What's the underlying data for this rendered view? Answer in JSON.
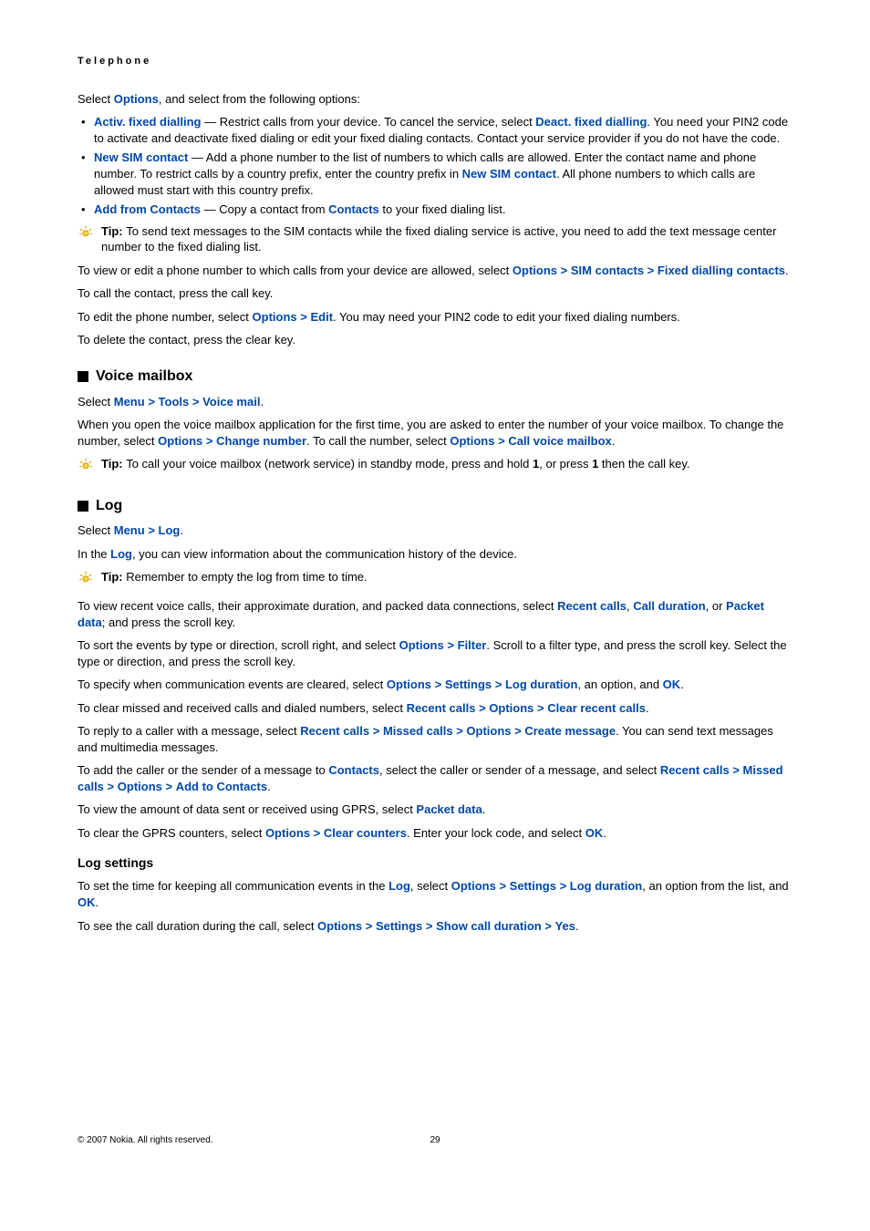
{
  "header": "Telephone",
  "p1": {
    "a": "Select ",
    "b": "Options",
    "c": ", and select from the following options:"
  },
  "bullets": [
    {
      "t1": "Activ. fixed dialling",
      "t2": " — Restrict calls from your device. To cancel the service, select ",
      "t3": "Deact. fixed dialling",
      "t4": ". You need your PIN2 code to activate and deactivate fixed dialing or edit your fixed dialing contacts. Contact your service provider if you do not have the code."
    },
    {
      "t1": "New SIM contact",
      "t2": " — Add a phone number to the list of numbers to which calls are allowed. Enter the contact name and phone number. To restrict calls by a country prefix, enter the country prefix in ",
      "t3": "New SIM contact",
      "t4": ". All phone numbers to which calls are allowed must start with this country prefix."
    },
    {
      "t1": "Add from Contacts",
      "t2": " — Copy a contact from ",
      "t3": "Contacts",
      "t4": " to your fixed dialing list."
    }
  ],
  "tip1": {
    "label": "Tip: ",
    "text": "To send text messages to the SIM contacts while the fixed dialing service is active, you need to add the text message center number to the fixed dialing list."
  },
  "p2": {
    "a": "To view or edit a phone number to which calls from your device are allowed, select ",
    "b": "Options",
    "c": "SIM contacts",
    "d": "Fixed dialling contacts",
    "dot": "."
  },
  "p3": "To call the contact, press the call key.",
  "p4": {
    "a": "To edit the phone number, select ",
    "b": "Options",
    "c": "Edit",
    "d": ". You may need your PIN2 code to edit your fixed dialing numbers."
  },
  "p5": "To delete the contact, press the clear key.",
  "sec_voice": "Voice mailbox",
  "p6": {
    "a": "Select ",
    "b": "Menu",
    "c": "Tools",
    "d": "Voice mail",
    "dot": "."
  },
  "p7": {
    "a": "When you open the voice mailbox application for the first time, you are asked to enter the number of your voice mailbox. To change the number, select ",
    "b": "Options",
    "c": "Change number",
    "d": ". To call the number, select ",
    "e": "Options",
    "f": "Call voice mailbox",
    "dot": "."
  },
  "tip2": {
    "label": "Tip: ",
    "text": "To call your voice mailbox (network service) in standby mode, press and hold ",
    "k1": "1",
    "mid": ", or press ",
    "k2": "1",
    "end": " then the call key."
  },
  "sec_log": "Log",
  "p8": {
    "a": "Select ",
    "b": "Menu",
    "c": "Log",
    "dot": "."
  },
  "p9": {
    "a": "In the ",
    "b": "Log",
    "c": ", you can view information about the communication history of the device."
  },
  "tip3": {
    "label": "Tip: ",
    "text": "Remember to empty the log from time to time."
  },
  "p10": {
    "a": "To view recent voice calls, their approximate duration, and packed data connections, select ",
    "b": "Recent calls",
    "c": ", ",
    "d": "Call duration",
    "e": ", or ",
    "f": "Packet data",
    "g": "; and press the scroll key."
  },
  "p11": {
    "a": "To sort the events by type or direction, scroll right, and select ",
    "b": "Options",
    "c": "Filter",
    "d": ". Scroll to a filter type, and press the scroll key. Select the type or direction, and press the scroll key."
  },
  "p12": {
    "a": "To specify when communication events are cleared, select ",
    "b": "Options",
    "c": "Settings",
    "d": "Log duration",
    "e": ", an option, and ",
    "f": "OK",
    "dot": "."
  },
  "p13": {
    "a": "To clear missed and received calls and dialed numbers, select ",
    "b": "Recent calls",
    "c": "Options",
    "d": "Clear recent calls",
    "dot": "."
  },
  "p14": {
    "a": "To reply to a caller with a message, select ",
    "b": "Recent calls",
    "c": "Missed calls",
    "d": "Options",
    "e": "Create message",
    "f": ". You can send text messages and multimedia messages."
  },
  "p15": {
    "a": "To add the caller or the sender of a message to ",
    "b": "Contacts",
    "c": ", select the caller or sender of a message, and select ",
    "d": "Recent calls",
    "e": "Missed calls",
    "f": "Options",
    "g": "Add to Contacts",
    "dot": "."
  },
  "p16": {
    "a": "To view the amount of data sent or received using GPRS, select ",
    "b": "Packet data",
    "dot": "."
  },
  "p17": {
    "a": "To clear the GPRS counters, select ",
    "b": "Options",
    "c": "Clear counters",
    "d": ". Enter your lock code, and select ",
    "e": "OK",
    "dot": "."
  },
  "sub_logsettings": "Log settings",
  "p18": {
    "a": "To set the time for keeping all communication events in the ",
    "b": "Log",
    "c": ", select ",
    "d": "Options",
    "e": "Settings",
    "f": "Log duration",
    "g": ", an option from the list, and ",
    "h": "OK",
    "dot": "."
  },
  "p19": {
    "a": "To see the call duration during the call, select ",
    "b": "Options",
    "c": "Settings",
    "d": "Show call duration",
    "e": "Yes",
    "dot": "."
  },
  "footer": {
    "copy": "© 2007 Nokia. All rights reserved.",
    "page": "29"
  },
  "chev": ">"
}
